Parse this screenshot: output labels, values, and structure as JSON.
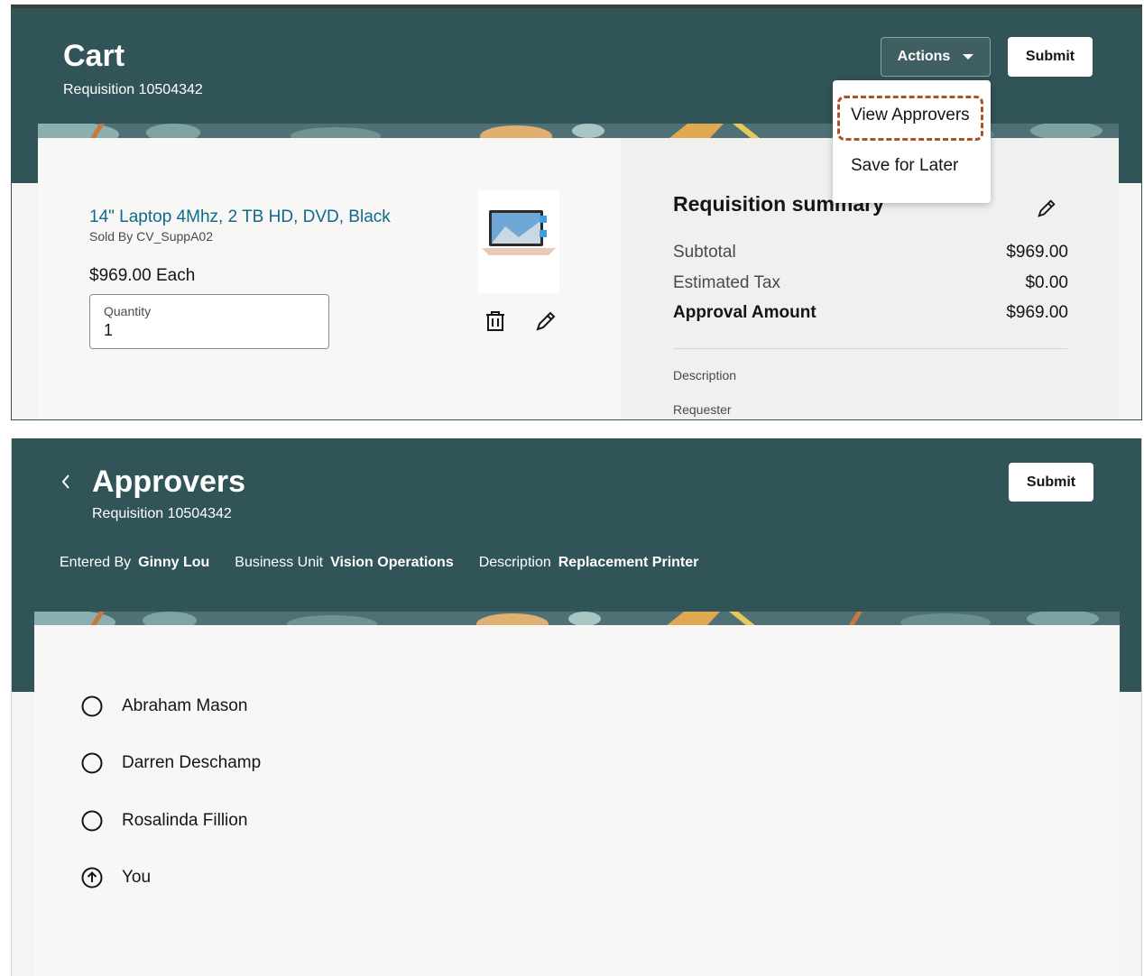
{
  "cart": {
    "title": "Cart",
    "requisition": "Requisition 10504342",
    "actions_label": "Actions",
    "submit_label": "Submit",
    "menu": [
      "View Approvers",
      "Save for Later"
    ],
    "item": {
      "name": "14\" Laptop 4Mhz, 2 TB HD, DVD, Black",
      "sold_by": "Sold By CV_SuppA02",
      "price": "$969.00 Each",
      "quantity_label": "Quantity",
      "quantity_value": "1"
    },
    "summary": {
      "title": "Requisition summary",
      "rows": [
        {
          "label": "Subtotal",
          "value": "$969.00"
        },
        {
          "label": "Estimated Tax",
          "value": "$0.00"
        },
        {
          "label": "Approval Amount",
          "value": "$969.00"
        }
      ],
      "description_label": "Description",
      "requester_label": "Requester"
    }
  },
  "approvers": {
    "title": "Approvers",
    "requisition": "Requisition 10504342",
    "submit_label": "Submit",
    "meta": {
      "entered_by_label": "Entered By",
      "entered_by_value": "Ginny Lou",
      "business_unit_label": "Business Unit",
      "business_unit_value": "Vision Operations",
      "description_label": "Description",
      "description_value": "Replacement Printer"
    },
    "list": [
      "Abraham Mason",
      "Darren Deschamp",
      "Rosalinda Fillion",
      "You"
    ]
  },
  "colors": {
    "header": "#315459",
    "accent_link": "#0b6b8a",
    "highlight": "#a8542a"
  },
  "icons": [
    "chevron-down-icon",
    "edit-pencil-icon",
    "trash-icon",
    "laptop-image",
    "back-chevron-icon",
    "circle-icon",
    "arrow-up-circle-icon"
  ]
}
